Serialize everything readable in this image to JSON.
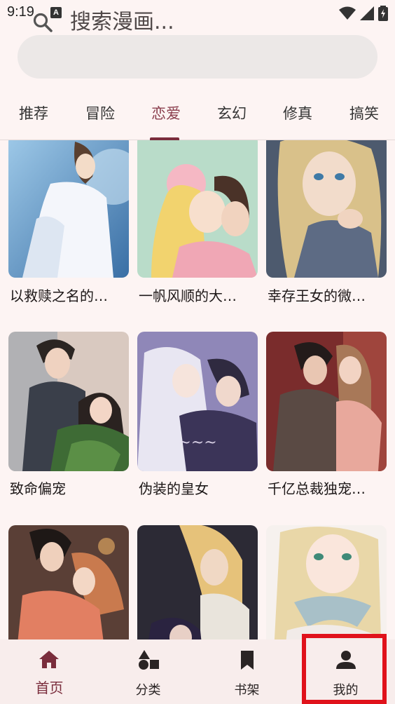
{
  "status_bar": {
    "time": "9:19",
    "notification_glyph": "A"
  },
  "search": {
    "placeholder": "搜索漫画..."
  },
  "tabs": [
    {
      "label": "推荐",
      "active": false
    },
    {
      "label": "冒险",
      "active": false
    },
    {
      "label": "恋爱",
      "active": true
    },
    {
      "label": "玄幻",
      "active": false
    },
    {
      "label": "修真",
      "active": false
    },
    {
      "label": "搞笑",
      "active": false
    }
  ],
  "comics": [
    {
      "title": "以救赎之名的…"
    },
    {
      "title": "一帆风顺的大…"
    },
    {
      "title": "幸存王女的微…"
    },
    {
      "title": "致命偏宠"
    },
    {
      "title": "伪装的皇女"
    },
    {
      "title": "千亿总裁独宠…"
    },
    {
      "title": ""
    },
    {
      "title": ""
    },
    {
      "title": ""
    }
  ],
  "bottom_nav": [
    {
      "label": "首页",
      "icon": "home-icon",
      "active": true
    },
    {
      "label": "分类",
      "icon": "category-icon",
      "active": false
    },
    {
      "label": "书架",
      "icon": "bookmark-icon",
      "active": false
    },
    {
      "label": "我的",
      "icon": "person-icon",
      "active": false
    }
  ],
  "colors": {
    "background": "#fdf4f3",
    "accent": "#7a2d3c",
    "search_bg": "#ece8e7",
    "nav_bg": "#f8edec",
    "highlight": "#e0121b"
  }
}
